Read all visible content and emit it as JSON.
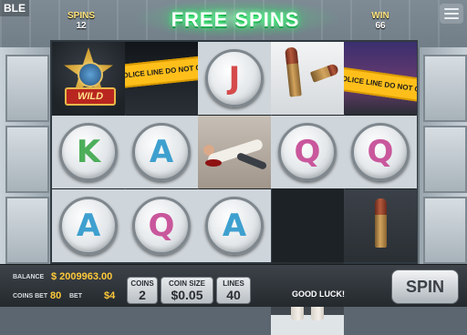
{
  "top": {
    "corner_label": "BLE",
    "title": "FREE SPINS",
    "spins_label": "SPINS",
    "spins_value": "12",
    "win_label": "WIN",
    "win_value": "66"
  },
  "reels": {
    "tape_text": "POLICE LINE DO NOT CROSS",
    "wild_text": "WILD",
    "letters": {
      "r1c2": "J",
      "r2c1": "K",
      "r2c2": "A",
      "r2c4": "Q",
      "r2c5": "Q",
      "r3c1": "A",
      "r3c2": "Q",
      "r3c3": "A"
    }
  },
  "panel": {
    "balance_label": "BALANCE",
    "balance_value": "$ 2009963.00",
    "coins_bet_label": "COINS BET",
    "coins_bet_value": "80",
    "bet_label": "BET",
    "bet_value": "$4",
    "coins_label": "COINS",
    "coins_value": "2",
    "coin_size_label": "COIN SIZE",
    "coin_size_value": "$0.05",
    "lines_label": "LINES",
    "lines_value": "40",
    "status": "GOOD LUCK!",
    "spin_label": "SPIN"
  },
  "colors": {
    "title_glow": "#37ff7a",
    "value_yellow": "#ffc93a",
    "tape_yellow": "#ffbf1a"
  }
}
